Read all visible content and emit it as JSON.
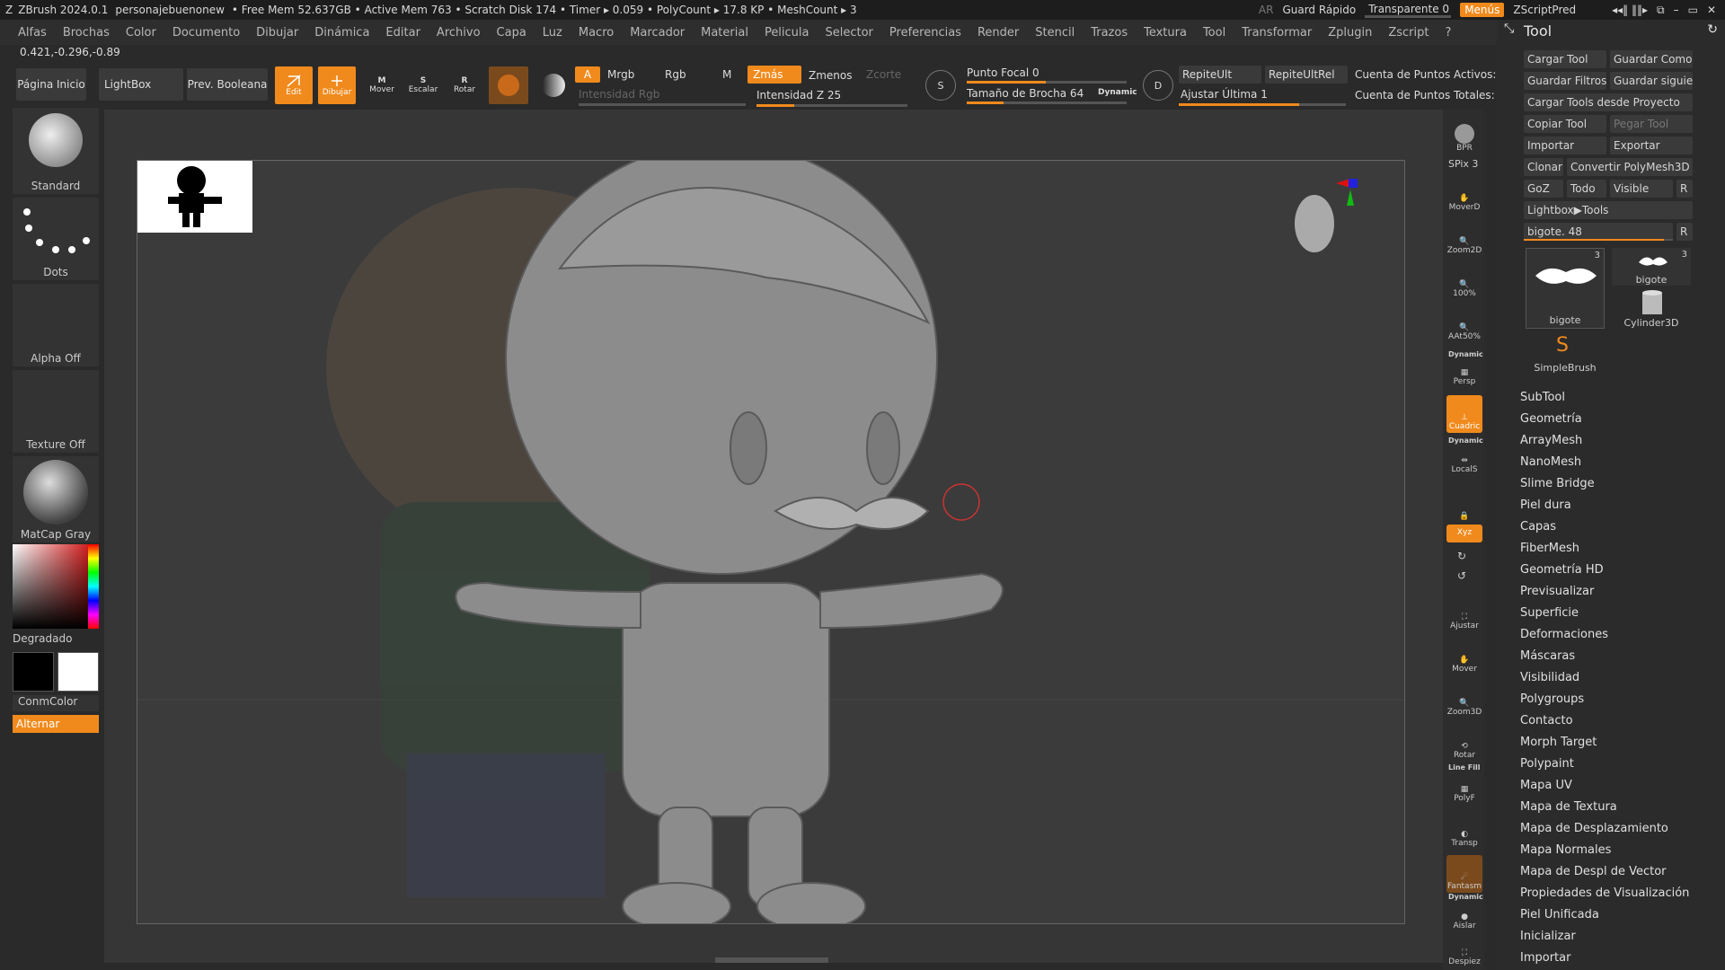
{
  "titlebar": {
    "app": "ZBrush 2024.0.1",
    "doc": "personajebuenonew",
    "free_mem": "• Free Mem 52.637GB",
    "active_mem": "• Active Mem 763",
    "scratch": "• Scratch Disk 174",
    "timer": "• Timer ▸ 0.059",
    "polycount": "• PolyCount ▸ 17.8 KP",
    "meshcount": "• MeshCount ▸ 3",
    "ar": "AR",
    "quicksave": "Guard Rápido",
    "transparent": "Transparente 0",
    "transparent_value": 0,
    "menus": "Menús",
    "script": "ZScriptPred"
  },
  "menubar": [
    "Alfas",
    "Brochas",
    "Color",
    "Documento",
    "Dibujar",
    "Dinámica",
    "Editar",
    "Archivo",
    "Capa",
    "Luz",
    "Macro",
    "Marcador",
    "Material",
    "Pelicula",
    "Selector",
    "Preferencias",
    "Render",
    "Stencil",
    "Trazos",
    "Textura",
    "Tool",
    "Transformar",
    "Zplugin",
    "Zscript",
    "?"
  ],
  "coords": "0.421,-0.296,-0.89",
  "toolbar": {
    "home": "Página Inicio",
    "lightbox": "LightBox",
    "boolean": "Prev. Booleana",
    "edit": "Edit",
    "draw": "Dibujar",
    "move": "Mover",
    "scale": "Escalar",
    "rotate": "Rotar",
    "a_toggle": "A",
    "mrgb": "Mrgb",
    "rgb": "Rgb",
    "m": "M",
    "zadd": "Zmás",
    "zsub": "Zmenos",
    "zcut": "Zcorte",
    "rgb_intensity": "Intensidad Rgb",
    "z_intensity": "Intensidad Z 25",
    "z_intensity_value": 25,
    "focal": "Punto Focal 0",
    "focal_value": 0,
    "brush_size": "Tamaño de Brocha 64",
    "brush_size_value": 64,
    "dynamic": "Dynamic",
    "repeat_last": "RepiteUlt",
    "repeat_last_rel": "RepiteUltRel",
    "adjust_last": "Ajustar Última 1",
    "active_points": "Cuenta de Puntos Activos:",
    "total_points": "Cuenta de Puntos Totales:"
  },
  "leftshelf": {
    "brush": "Standard",
    "stroke": "Dots",
    "alpha": "Alpha Off",
    "texture": "Texture Off",
    "material": "MatCap Gray",
    "gradient": "Degradado",
    "switch_color": "ConmColor",
    "alternate": "Alternar"
  },
  "rightshelf": {
    "bpr": "BPR",
    "spix": "SPix 3",
    "move2d": "MoverD",
    "zoom2d": "Zoom2D",
    "zoom100": "100%",
    "aahalf": "AAt50%",
    "dynamic_label": "Dynamic",
    "persp": "Persp",
    "floor": "Cuadric",
    "dynamic_label2": "Dynamic",
    "local": "LocalS",
    "xyz": "Xyz",
    "frame": "Ajustar",
    "move": "Mover",
    "zoom3d": "Zoom3D",
    "rotate": "Rotar",
    "linefill": "Line Fill",
    "polyf": "PolyF",
    "transp": "Transp",
    "ghost": "Fantasm",
    "dynamic_label3": "Dynamic",
    "solo": "Aislar",
    "xpose": "Despiez"
  },
  "toolpanel": {
    "title": "Tool",
    "buttons": {
      "load": "Cargar Tool",
      "save_as": "Guardar Como",
      "save_filters": "Guardar Filtros",
      "save_next": "Guardar siguien",
      "load_project": "Cargar Tools desde Proyecto",
      "copy": "Copiar Tool",
      "paste": "Pegar Tool",
      "import": "Importar",
      "export": "Exportar",
      "clone": "Clonar",
      "polymesh": "Convertir PolyMesh3D",
      "goz": "GoZ",
      "all": "Todo",
      "visible": "Visible",
      "r": "R",
      "lightbox_tools": "Lightbox▶Tools",
      "current": "bigote. 48",
      "current_value": 48
    },
    "thumbs": [
      {
        "name": "bigote",
        "count": "3"
      },
      {
        "name": "bigote",
        "count": "3"
      },
      {
        "name": "Cylinder3D",
        "count": ""
      },
      {
        "name": "SimpleBrush",
        "count": ""
      }
    ],
    "sections": [
      "SubTool",
      "Geometría",
      "ArrayMesh",
      "NanoMesh",
      "Slime Bridge",
      "Piel dura",
      "Capas",
      "FiberMesh",
      "Geometría HD",
      "Previsualizar",
      "Superficie",
      "Deformaciones",
      "Máscaras",
      "Visibilidad",
      "Polygroups",
      "Contacto",
      "Morph Target",
      "Polypaint",
      "Mapa UV",
      "Mapa de Textura",
      "Mapa de Desplazamiento",
      "Mapa Normales",
      "Mapa de Despl de Vector",
      "Propiedades de Visualización",
      "Piel Unificada",
      "Inicializar",
      "Importar"
    ]
  },
  "colors": {
    "accent": "#f08a1c",
    "background": "#2a2a2a",
    "canvas": "#363636"
  }
}
